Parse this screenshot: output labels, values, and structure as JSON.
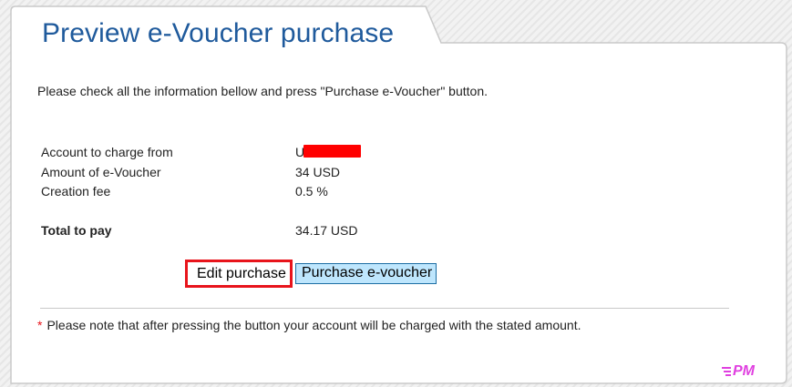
{
  "page": {
    "title": "Preview e-Voucher purchase",
    "intro": "Please check all the information bellow and press \"Purchase e-Voucher\" button."
  },
  "details": {
    "account": {
      "label": "Account to charge from",
      "value": "U"
    },
    "amount": {
      "label": "Amount of e-Voucher",
      "value": "34 USD"
    },
    "fee": {
      "label": "Creation fee",
      "value": "0.5 %"
    },
    "total": {
      "label": "Total to pay",
      "value": "34.17 USD"
    }
  },
  "actions": {
    "edit_label": "Edit purchase",
    "purchase_label": "Purchase e-voucher"
  },
  "note": {
    "asterisk": "*",
    "text": "Please note that after pressing the button your account will be charged with the stated amount."
  },
  "logo": {
    "text": "PM",
    "color": "#e040e0"
  },
  "colors": {
    "title": "#1f5a9c",
    "highlight": "#e8141b",
    "redaction": "#ff0000",
    "purchase_button_bg": "#bee6fd",
    "purchase_button_border": "#1c6ea4"
  }
}
